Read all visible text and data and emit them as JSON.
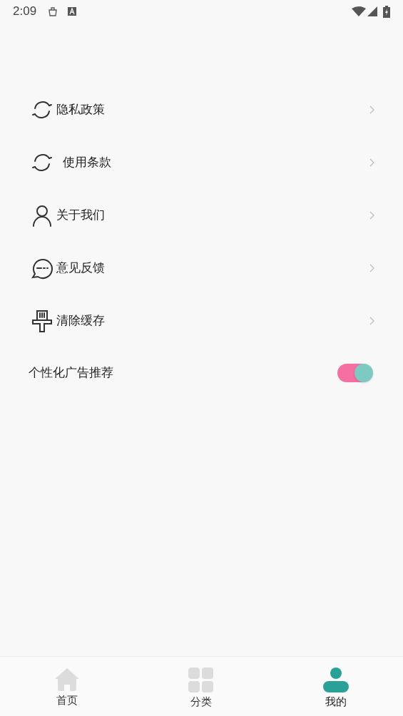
{
  "status_bar": {
    "time": "2:09"
  },
  "menu": [
    {
      "kind": "privacy",
      "label": "隐私政策"
    },
    {
      "kind": "terms",
      "label": "使用条款"
    },
    {
      "kind": "about",
      "label": "关于我们"
    },
    {
      "kind": "feedback",
      "label": "意见反馈"
    },
    {
      "kind": "cache",
      "label": "清除缓存"
    }
  ],
  "ad_toggle": {
    "label": "个性化广告推荐",
    "on": true
  },
  "nav": [
    {
      "kind": "home",
      "label": "首页",
      "selected": false
    },
    {
      "kind": "category",
      "label": "分类",
      "selected": false
    },
    {
      "kind": "mine",
      "label": "我的",
      "selected": true
    }
  ]
}
